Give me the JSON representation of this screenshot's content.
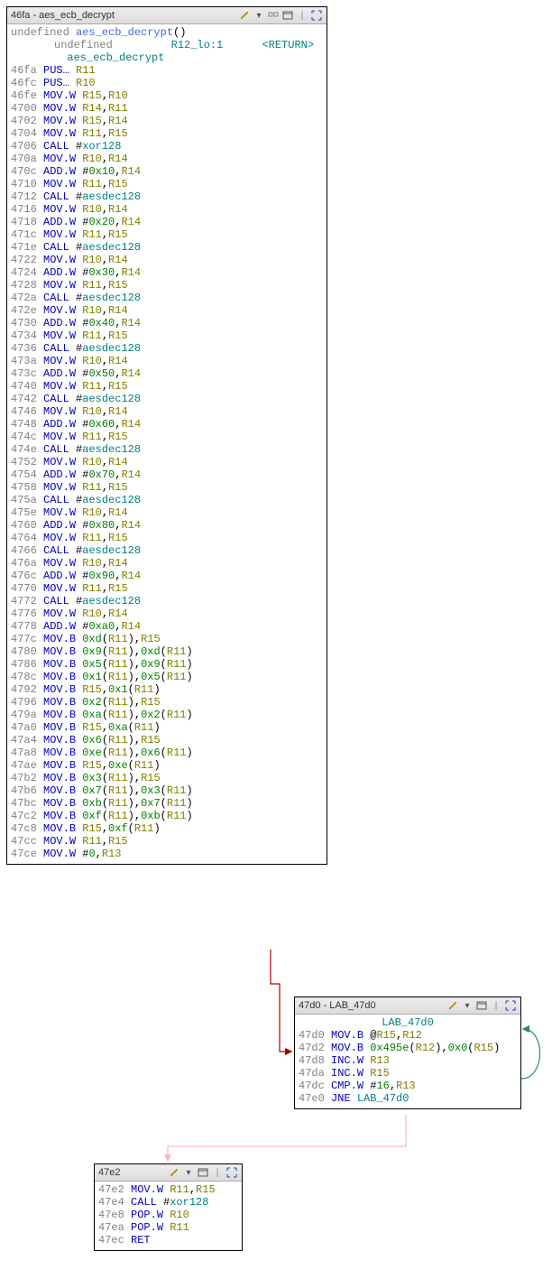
{
  "block1": {
    "title": "46fa - aes_ecb_decrypt",
    "sig_prefix": "undefined ",
    "sig_name": "aes_ecb_decrypt",
    "sig_suffix": "()",
    "hdr_line1_type": "undefined",
    "hdr_line1_reg": "R12_lo:1",
    "hdr_line1_ret": "<RETURN>",
    "hdr_line2_name": "aes_ecb_decrypt",
    "instructions": [
      {
        "addr": "46fa",
        "mnem": "PUS…",
        "op": [
          "reg:R11"
        ]
      },
      {
        "addr": "46fc",
        "mnem": "PUS…",
        "op": [
          "reg:R10"
        ]
      },
      {
        "addr": "46fe",
        "mnem": "MOV.W",
        "op": [
          "reg:R15",
          "punct:,",
          "reg:R10"
        ]
      },
      {
        "addr": "4700",
        "mnem": "MOV.W",
        "op": [
          "reg:R14",
          "punct:,",
          "reg:R11"
        ]
      },
      {
        "addr": "4702",
        "mnem": "MOV.W",
        "op": [
          "reg:R15",
          "punct:,",
          "reg:R14"
        ]
      },
      {
        "addr": "4704",
        "mnem": "MOV.W",
        "op": [
          "reg:R11",
          "punct:,",
          "reg:R15"
        ]
      },
      {
        "addr": "4706",
        "mnem": "CALL",
        "op": [
          "punct: #",
          "lbl:xor128"
        ]
      },
      {
        "addr": "470a",
        "mnem": "MOV.W",
        "op": [
          "reg:R10",
          "punct:,",
          "reg:R14"
        ]
      },
      {
        "addr": "470c",
        "mnem": "ADD.W",
        "op": [
          "punct:#",
          "imm:0x10",
          "punct:,",
          "reg:R14"
        ]
      },
      {
        "addr": "4710",
        "mnem": "MOV.W",
        "op": [
          "reg:R11",
          "punct:,",
          "reg:R15"
        ]
      },
      {
        "addr": "4712",
        "mnem": "CALL",
        "op": [
          "punct: #",
          "lbl:aesdec128"
        ]
      },
      {
        "addr": "4716",
        "mnem": "MOV.W",
        "op": [
          "reg:R10",
          "punct:,",
          "reg:R14"
        ]
      },
      {
        "addr": "4718",
        "mnem": "ADD.W",
        "op": [
          "punct:#",
          "imm:0x20",
          "punct:,",
          "reg:R14"
        ]
      },
      {
        "addr": "471c",
        "mnem": "MOV.W",
        "op": [
          "reg:R11",
          "punct:,",
          "reg:R15"
        ]
      },
      {
        "addr": "471e",
        "mnem": "CALL",
        "op": [
          "punct: #",
          "lbl:aesdec128"
        ]
      },
      {
        "addr": "4722",
        "mnem": "MOV.W",
        "op": [
          "reg:R10",
          "punct:,",
          "reg:R14"
        ]
      },
      {
        "addr": "4724",
        "mnem": "ADD.W",
        "op": [
          "punct:#",
          "imm:0x30",
          "punct:,",
          "reg:R14"
        ]
      },
      {
        "addr": "4728",
        "mnem": "MOV.W",
        "op": [
          "reg:R11",
          "punct:,",
          "reg:R15"
        ]
      },
      {
        "addr": "472a",
        "mnem": "CALL",
        "op": [
          "punct: #",
          "lbl:aesdec128"
        ]
      },
      {
        "addr": "472e",
        "mnem": "MOV.W",
        "op": [
          "reg:R10",
          "punct:,",
          "reg:R14"
        ]
      },
      {
        "addr": "4730",
        "mnem": "ADD.W",
        "op": [
          "punct:#",
          "imm:0x40",
          "punct:,",
          "reg:R14"
        ]
      },
      {
        "addr": "4734",
        "mnem": "MOV.W",
        "op": [
          "reg:R11",
          "punct:,",
          "reg:R15"
        ]
      },
      {
        "addr": "4736",
        "mnem": "CALL",
        "op": [
          "punct: #",
          "lbl:aesdec128"
        ]
      },
      {
        "addr": "473a",
        "mnem": "MOV.W",
        "op": [
          "reg:R10",
          "punct:,",
          "reg:R14"
        ]
      },
      {
        "addr": "473c",
        "mnem": "ADD.W",
        "op": [
          "punct:#",
          "imm:0x50",
          "punct:,",
          "reg:R14"
        ]
      },
      {
        "addr": "4740",
        "mnem": "MOV.W",
        "op": [
          "reg:R11",
          "punct:,",
          "reg:R15"
        ]
      },
      {
        "addr": "4742",
        "mnem": "CALL",
        "op": [
          "punct: #",
          "lbl:aesdec128"
        ]
      },
      {
        "addr": "4746",
        "mnem": "MOV.W",
        "op": [
          "reg:R10",
          "punct:,",
          "reg:R14"
        ]
      },
      {
        "addr": "4748",
        "mnem": "ADD.W",
        "op": [
          "punct:#",
          "imm:0x60",
          "punct:,",
          "reg:R14"
        ]
      },
      {
        "addr": "474c",
        "mnem": "MOV.W",
        "op": [
          "reg:R11",
          "punct:,",
          "reg:R15"
        ]
      },
      {
        "addr": "474e",
        "mnem": "CALL",
        "op": [
          "punct: #",
          "lbl:aesdec128"
        ]
      },
      {
        "addr": "4752",
        "mnem": "MOV.W",
        "op": [
          "reg:R10",
          "punct:,",
          "reg:R14"
        ]
      },
      {
        "addr": "4754",
        "mnem": "ADD.W",
        "op": [
          "punct:#",
          "imm:0x70",
          "punct:,",
          "reg:R14"
        ]
      },
      {
        "addr": "4758",
        "mnem": "MOV.W",
        "op": [
          "reg:R11",
          "punct:,",
          "reg:R15"
        ]
      },
      {
        "addr": "475a",
        "mnem": "CALL",
        "op": [
          "punct: #",
          "lbl:aesdec128"
        ]
      },
      {
        "addr": "475e",
        "mnem": "MOV.W",
        "op": [
          "reg:R10",
          "punct:,",
          "reg:R14"
        ]
      },
      {
        "addr": "4760",
        "mnem": "ADD.W",
        "op": [
          "punct:#",
          "imm:0x80",
          "punct:,",
          "reg:R14"
        ]
      },
      {
        "addr": "4764",
        "mnem": "MOV.W",
        "op": [
          "reg:R11",
          "punct:,",
          "reg:R15"
        ]
      },
      {
        "addr": "4766",
        "mnem": "CALL",
        "op": [
          "punct: #",
          "lbl:aesdec128"
        ]
      },
      {
        "addr": "476a",
        "mnem": "MOV.W",
        "op": [
          "reg:R10",
          "punct:,",
          "reg:R14"
        ]
      },
      {
        "addr": "476c",
        "mnem": "ADD.W",
        "op": [
          "punct:#",
          "imm:0x90",
          "punct:,",
          "reg:R14"
        ]
      },
      {
        "addr": "4770",
        "mnem": "MOV.W",
        "op": [
          "reg:R11",
          "punct:,",
          "reg:R15"
        ]
      },
      {
        "addr": "4772",
        "mnem": "CALL",
        "op": [
          "punct: #",
          "lbl:aesdec128"
        ]
      },
      {
        "addr": "4776",
        "mnem": "MOV.W",
        "op": [
          "reg:R10",
          "punct:,",
          "reg:R14"
        ]
      },
      {
        "addr": "4778",
        "mnem": "ADD.W",
        "op": [
          "punct:#",
          "imm:0xa0",
          "punct:,",
          "reg:R14"
        ]
      },
      {
        "addr": "477c",
        "mnem": "MOV.B",
        "op": [
          "imm:0xd",
          "punct:(",
          "reg:R11",
          "punct:),",
          "reg:R15"
        ]
      },
      {
        "addr": "4780",
        "mnem": "MOV.B",
        "op": [
          "imm:0x9",
          "punct:(",
          "reg:R11",
          "punct:),",
          "imm:0xd",
          "punct:(",
          "reg:R11",
          "punct:)"
        ]
      },
      {
        "addr": "4786",
        "mnem": "MOV.B",
        "op": [
          "imm:0x5",
          "punct:(",
          "reg:R11",
          "punct:),",
          "imm:0x9",
          "punct:(",
          "reg:R11",
          "punct:)"
        ]
      },
      {
        "addr": "478c",
        "mnem": "MOV.B",
        "op": [
          "imm:0x1",
          "punct:(",
          "reg:R11",
          "punct:),",
          "imm:0x5",
          "punct:(",
          "reg:R11",
          "punct:)"
        ]
      },
      {
        "addr": "4792",
        "mnem": "MOV.B",
        "op": [
          "reg:R15",
          "punct:,",
          "imm:0x1",
          "punct:(",
          "reg:R11",
          "punct:)"
        ]
      },
      {
        "addr": "4796",
        "mnem": "MOV.B",
        "op": [
          "imm:0x2",
          "punct:(",
          "reg:R11",
          "punct:),",
          "reg:R15"
        ]
      },
      {
        "addr": "479a",
        "mnem": "MOV.B",
        "op": [
          "imm:0xa",
          "punct:(",
          "reg:R11",
          "punct:),",
          "imm:0x2",
          "punct:(",
          "reg:R11",
          "punct:)"
        ]
      },
      {
        "addr": "47a0",
        "mnem": "MOV.B",
        "op": [
          "reg:R15",
          "punct:,",
          "imm:0xa",
          "punct:(",
          "reg:R11",
          "punct:)"
        ]
      },
      {
        "addr": "47a4",
        "mnem": "MOV.B",
        "op": [
          "imm:0x6",
          "punct:(",
          "reg:R11",
          "punct:),",
          "reg:R15"
        ]
      },
      {
        "addr": "47a8",
        "mnem": "MOV.B",
        "op": [
          "imm:0xe",
          "punct:(",
          "reg:R11",
          "punct:),",
          "imm:0x6",
          "punct:(",
          "reg:R11",
          "punct:)"
        ]
      },
      {
        "addr": "47ae",
        "mnem": "MOV.B",
        "op": [
          "reg:R15",
          "punct:,",
          "imm:0xe",
          "punct:(",
          "reg:R11",
          "punct:)"
        ]
      },
      {
        "addr": "47b2",
        "mnem": "MOV.B",
        "op": [
          "imm:0x3",
          "punct:(",
          "reg:R11",
          "punct:),",
          "reg:R15"
        ]
      },
      {
        "addr": "47b6",
        "mnem": "MOV.B",
        "op": [
          "imm:0x7",
          "punct:(",
          "reg:R11",
          "punct:),",
          "imm:0x3",
          "punct:(",
          "reg:R11",
          "punct:)"
        ]
      },
      {
        "addr": "47bc",
        "mnem": "MOV.B",
        "op": [
          "imm:0xb",
          "punct:(",
          "reg:R11",
          "punct:),",
          "imm:0x7",
          "punct:(",
          "reg:R11",
          "punct:)"
        ]
      },
      {
        "addr": "47c2",
        "mnem": "MOV.B",
        "op": [
          "imm:0xf",
          "punct:(",
          "reg:R11",
          "punct:),",
          "imm:0xb",
          "punct:(",
          "reg:R11",
          "punct:)"
        ]
      },
      {
        "addr": "47c8",
        "mnem": "MOV.B",
        "op": [
          "reg:R15",
          "punct:,",
          "imm:0xf",
          "punct:(",
          "reg:R11",
          "punct:)"
        ]
      },
      {
        "addr": "47cc",
        "mnem": "MOV.W",
        "op": [
          "reg:R11",
          "punct:,",
          "reg:R15"
        ]
      },
      {
        "addr": "47ce",
        "mnem": "MOV.W",
        "op": [
          "punct:#",
          "imm:0",
          "punct:,",
          "reg:R13"
        ]
      }
    ]
  },
  "block2": {
    "title": "47d0 - LAB_47d0",
    "label": "LAB_47d0",
    "instructions": [
      {
        "addr": "47d0",
        "mnem": "MOV.B",
        "op": [
          "punct:@",
          "reg:R15",
          "punct:,",
          "reg:R12"
        ]
      },
      {
        "addr": "47d2",
        "mnem": "MOV.B",
        "op": [
          "imm:0x495e",
          "punct:(",
          "reg:R12",
          "punct:),",
          "imm:0x0",
          "punct:(",
          "reg:R15",
          "punct:)"
        ]
      },
      {
        "addr": "47d8",
        "mnem": "INC.W",
        "op": [
          "reg:R13"
        ]
      },
      {
        "addr": "47da",
        "mnem": "INC.W",
        "op": [
          "reg:R15"
        ]
      },
      {
        "addr": "47dc",
        "mnem": "CMP.W",
        "op": [
          "punct:#",
          "imm:16",
          "punct:,",
          "reg:R13"
        ]
      },
      {
        "addr": "47e0",
        "mnem": "JNE",
        "op": [
          "txt:  ",
          "lbl:LAB_47d0"
        ]
      }
    ]
  },
  "block3": {
    "title": "47e2",
    "instructions": [
      {
        "addr": "47e2",
        "mnem": "MOV.W",
        "op": [
          "reg:R11",
          "punct:,",
          "reg:R15"
        ]
      },
      {
        "addr": "47e4",
        "mnem": "CALL",
        "op": [
          "punct: #",
          "lbl:xor128"
        ]
      },
      {
        "addr": "47e8",
        "mnem": "POP.W",
        "op": [
          "reg:R10"
        ]
      },
      {
        "addr": "47ea",
        "mnem": "POP.W",
        "op": [
          "reg:R11"
        ]
      },
      {
        "addr": "47ec",
        "mnem": "RET",
        "op": []
      }
    ]
  }
}
